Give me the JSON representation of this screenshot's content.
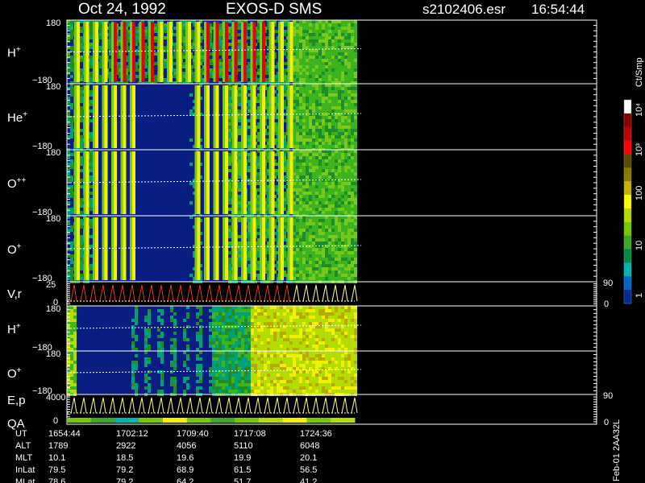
{
  "header": {
    "date": "Oct 24, 1992",
    "instrument": "EXOS-D SMS",
    "file": "s2102406.esr",
    "time": "16:54:44"
  },
  "footer_id": "Feb-01 2AA32L",
  "colorbar": {
    "title": "Ct/Smp",
    "labels": [
      "10⁴",
      "10³",
      "100",
      "10",
      "1"
    ],
    "colors": [
      "#ffffff",
      "#8b0000",
      "#c00000",
      "#ff0000",
      "#5a4a00",
      "#8a7a00",
      "#c8b400",
      "#ffff00",
      "#b4dc00",
      "#78c800",
      "#3caa28",
      "#008c46",
      "#00b4b4",
      "#0064c8",
      "#002896"
    ]
  },
  "panels": [
    {
      "label": "H",
      "sup": "+",
      "y_top": "180",
      "y_bot": "−180"
    },
    {
      "label": "He",
      "sup": "+",
      "y_top": "180",
      "y_bot": "−180"
    },
    {
      "label": "O",
      "sup": "++",
      "y_top": "180",
      "y_bot": "−180"
    },
    {
      "label": "O",
      "sup": "+",
      "y_top": "180",
      "y_bot": "−180"
    },
    {
      "label": "V,r",
      "sup": "",
      "y_top": "25",
      "y_bot": "0",
      "r_top": "90",
      "r_bot": "0"
    },
    {
      "label": "H",
      "sup": "+",
      "y_top": "180",
      "y_bot": "−180"
    },
    {
      "label": "O",
      "sup": "+",
      "y_top": "180",
      "y_bot": "−180"
    },
    {
      "label": "E,p",
      "sup": "",
      "label2": "QA",
      "y_top": "4000",
      "y_bot": "0",
      "r_top": "90",
      "r_bot": "0"
    }
  ],
  "orbit_table": {
    "rows": [
      {
        "name": "UT",
        "values": [
          "1654:44",
          "1702:12",
          "1709:40",
          "1717:08",
          "1724:36"
        ]
      },
      {
        "name": "ALT",
        "values": [
          "1789",
          "2922",
          "4056",
          "5110",
          "6048"
        ]
      },
      {
        "name": "MLT",
        "values": [
          "10.1",
          "18.5",
          "19.6",
          "19.9",
          "20.1"
        ]
      },
      {
        "name": "InLat",
        "values": [
          "79.5",
          "79.2",
          "68.9",
          "61.5",
          "56.5"
        ]
      },
      {
        "name": "MLat",
        "values": [
          "78.6",
          "79.2",
          "64.2",
          "51.7",
          "41.2"
        ]
      }
    ]
  },
  "chart_data": {
    "type": "heatmap",
    "x": [
      "1654:44",
      "1702:12",
      "1709:40",
      "1717:08",
      "1724:36"
    ],
    "series": [
      {
        "name": "H+"
      },
      {
        "name": "He+"
      },
      {
        "name": "O++"
      },
      {
        "name": "O+"
      },
      {
        "name": "V,r"
      },
      {
        "name": "H+"
      },
      {
        "name": "O+"
      },
      {
        "name": "E,p"
      }
    ],
    "color_scale": "log",
    "color_range": [
      1,
      10000
    ]
  }
}
